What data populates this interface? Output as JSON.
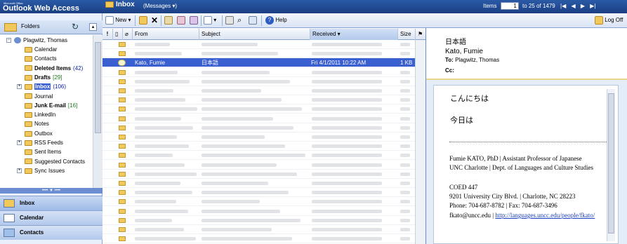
{
  "app": {
    "brand_small": "Microsoft Office",
    "title": "Outlook Web Access"
  },
  "header": {
    "folder_title": "Inbox",
    "view_label": "(Messages",
    "pager": {
      "items_label": "Items",
      "page_value": "1",
      "range_text": "to 25 of 1479"
    },
    "logoff_label": "Log Off"
  },
  "toolbar": {
    "new_label": "New",
    "help_label": "Help"
  },
  "sidebar": {
    "folders_label": "Folders",
    "owner": "Plagwitz, Thomas",
    "items": [
      {
        "label": "Calendar",
        "bold": false,
        "count": ""
      },
      {
        "label": "Contacts",
        "bold": false,
        "count": ""
      },
      {
        "label": "Deleted Items",
        "bold": true,
        "count": "(42)"
      },
      {
        "label": "Drafts",
        "bold": true,
        "count": "[29]"
      },
      {
        "label": "Inbox",
        "bold": true,
        "count": "(106)",
        "selected": true
      },
      {
        "label": "Journal",
        "bold": false,
        "count": ""
      },
      {
        "label": "Junk E-mail",
        "bold": true,
        "count": "[16]"
      },
      {
        "label": "LinkedIn",
        "bold": false,
        "count": ""
      },
      {
        "label": "Notes",
        "bold": false,
        "count": ""
      },
      {
        "label": "Outbox",
        "bold": false,
        "count": ""
      },
      {
        "label": "RSS Feeds",
        "bold": false,
        "count": ""
      },
      {
        "label": "Sent Items",
        "bold": false,
        "count": ""
      },
      {
        "label": "Suggested Contacts",
        "bold": false,
        "count": ""
      },
      {
        "label": "Sync Issues",
        "bold": false,
        "count": ""
      }
    ],
    "nav": [
      "Inbox",
      "Calendar",
      "Contacts"
    ]
  },
  "list": {
    "columns": {
      "importance": "!",
      "type": "",
      "attach": "",
      "from": "From",
      "subject": "Subject",
      "received": "Received",
      "size": "Size"
    },
    "selected_row": {
      "from": "Kato, Fumie",
      "subject": "日本語",
      "received": "Fri 4/1/2011 10:22 AM",
      "size": "1 KB"
    }
  },
  "reading": {
    "subject": "日本語",
    "from": "Kato, Fumie",
    "to_label": "To:",
    "to_value": "Plagwitz, Thomas",
    "cc_label": "Cc:",
    "body": {
      "line1": "こんにちは",
      "line2": "今日は",
      "sig1": "Fumie KATO, PhD | Assistant Professor of Japanese",
      "sig2": "UNC Charlotte | Dept. of Languages and Culture Studies",
      "sig3": "COED 447",
      "sig4": "9201 University City Blvd. | Charlotte, NC 28223",
      "sig5": "Phone: 704-687-8782 | Fax: 704-687-3496",
      "sig6_email": "fkato@uncc.edu |",
      "sig6_url": "http://languages.uncc.edu/people/fkato/"
    }
  },
  "colors": {
    "header_blue": "#1b3f84",
    "selection_blue": "#3a5fd0",
    "unread_count": "#0a1fa8",
    "junk_count": "#1f7a1f"
  }
}
